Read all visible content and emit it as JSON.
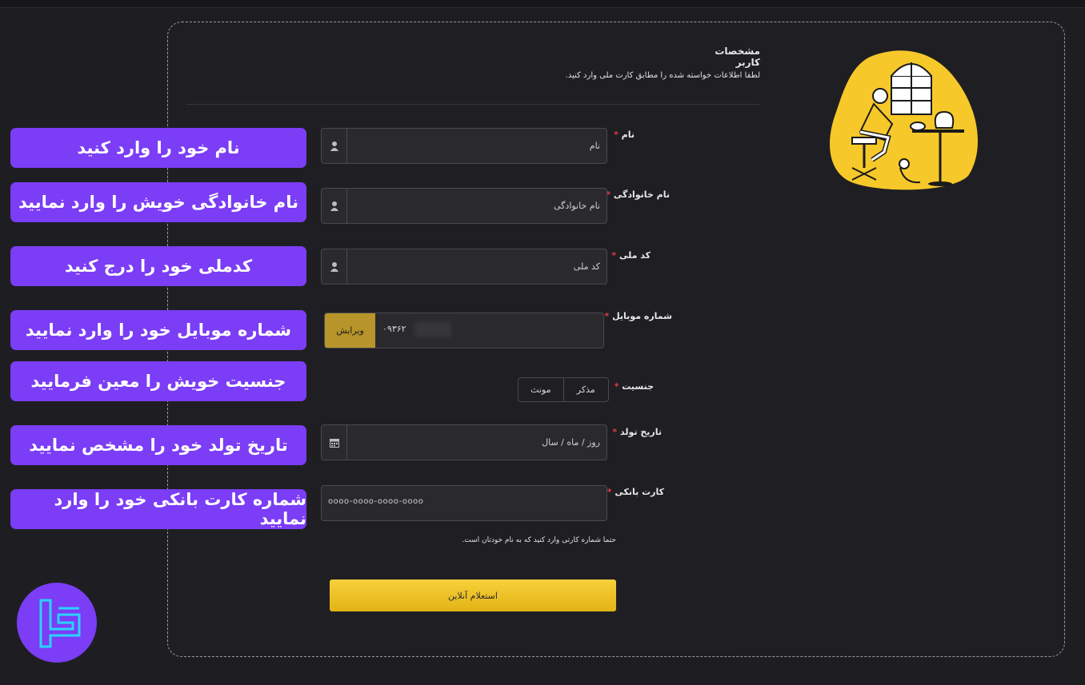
{
  "header": {
    "title": "مشخصات کاربر",
    "subtitle": "لطفا اطلاعات خواسته شده را مطابق کارت ملی وارد کنید."
  },
  "fields": {
    "first_name": {
      "label": "نام",
      "placeholder": "نام",
      "icon": "user-icon"
    },
    "last_name": {
      "label": "نام خانوادگی",
      "placeholder": "نام خانوادگی",
      "icon": "user-icon"
    },
    "national_code": {
      "label": "کد ملی",
      "placeholder": "کد ملی",
      "icon": "user-icon"
    },
    "mobile": {
      "label": "شماره موبایل",
      "value": "۰۹۳۶۲",
      "edit_label": "ویرایش"
    },
    "gender": {
      "label": "جنسیت",
      "options": [
        "مذکر",
        "مونث"
      ]
    },
    "birth_date": {
      "label": "تاریخ تولد",
      "placeholder": "روز / ماه / سال",
      "icon": "calendar-icon"
    },
    "bank_card": {
      "label": "کارت بانکی",
      "placeholder": "oooo-oooo-oooo-oooo",
      "hint": "حتما شماره کارتی وارد کنید که به نام خودتان است."
    }
  },
  "required_mark": "*",
  "submit_label": "استعلام آنلاین",
  "annotations": [
    "نام خود را وارد کنید",
    "نام خانوادگی خویش را وارد نمایید",
    "کدملی خود را درج کنید",
    "شماره موبایل خود را وارد نمایید",
    "جنسیت خویش را معین فرمایید",
    "تاریخ تولد خود را مشخص نمایید",
    "شماره کارت بانکی خود را وارد نمایید"
  ],
  "colors": {
    "background": "#1e1e22",
    "accent_yellow": "#f2c21f",
    "annotation_purple": "#7b3df5",
    "required_red": "#e03a4a",
    "logo_cyan": "#29d3ff"
  }
}
